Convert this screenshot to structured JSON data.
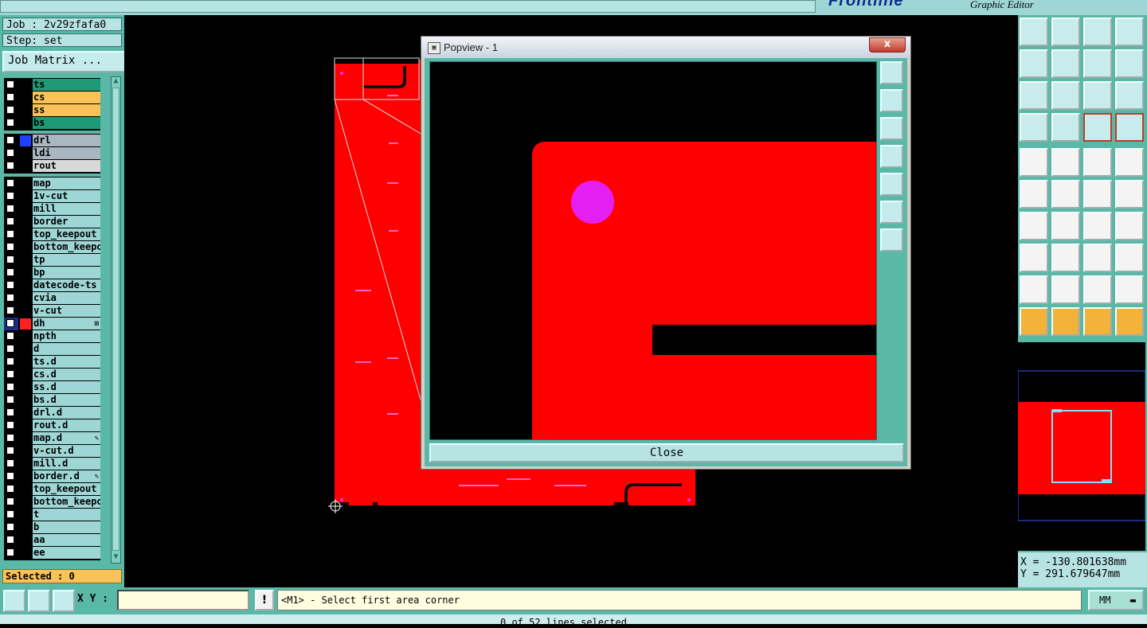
{
  "app": {
    "brand": "Frontline",
    "subtitle": "Graphic Editor"
  },
  "job": {
    "job_line": "Job : 2v29zfafa0",
    "step_line": "Step: set",
    "matrix_button": "Job Matrix ..."
  },
  "layers": [
    {
      "name": "ts",
      "color": "#1f9a76"
    },
    {
      "name": "cs",
      "color": "#f9c35a"
    },
    {
      "name": "ss",
      "color": "#f9c35a"
    },
    {
      "name": "bs",
      "color": "#1f9a76"
    },
    {
      "name": "drl",
      "color": "#a9b7c0",
      "swatch": "#1e40ff"
    },
    {
      "name": "ldi",
      "color": "#a9b7c0"
    },
    {
      "name": "rout",
      "color": "#d8d8d8"
    },
    {
      "name": "map",
      "color": "#9ed6d6"
    },
    {
      "name": "1v-cut",
      "color": "#9ed6d6"
    },
    {
      "name": "mill",
      "color": "#9ed6d6"
    },
    {
      "name": "border",
      "color": "#9ed6d6"
    },
    {
      "name": "top_keepout",
      "color": "#9ed6d6"
    },
    {
      "name": "bottom_keepout",
      "color": "#9ed6d6"
    },
    {
      "name": "tp",
      "color": "#9ed6d6"
    },
    {
      "name": "bp",
      "color": "#9ed6d6"
    },
    {
      "name": "datecode-ts",
      "color": "#9ed6d6"
    },
    {
      "name": "cvia",
      "color": "#9ed6d6"
    },
    {
      "name": "v-cut",
      "color": "#9ed6d6"
    },
    {
      "name": "dh",
      "color": "#9ed6d6",
      "swatch": "#ff2020",
      "active": true,
      "mark": "⊞"
    },
    {
      "name": "npth",
      "color": "#9ed6d6"
    },
    {
      "name": "d",
      "color": "#9ed6d6"
    },
    {
      "name": "ts.d",
      "color": "#9ed6d6"
    },
    {
      "name": "cs.d",
      "color": "#9ed6d6"
    },
    {
      "name": "ss.d",
      "color": "#9ed6d6"
    },
    {
      "name": "bs.d",
      "color": "#9ed6d6"
    },
    {
      "name": "drl.d",
      "color": "#9ed6d6"
    },
    {
      "name": "rout.d",
      "color": "#9ed6d6"
    },
    {
      "name": "map.d",
      "color": "#9ed6d6",
      "mark": "✎"
    },
    {
      "name": "v-cut.d",
      "color": "#9ed6d6"
    },
    {
      "name": "mill.d",
      "color": "#9ed6d6"
    },
    {
      "name": "border.d",
      "color": "#9ed6d6",
      "mark": "✎"
    },
    {
      "name": "top_keepout",
      "color": "#9ed6d6"
    },
    {
      "name": "bottom_keepout",
      "color": "#9ed6d6"
    },
    {
      "name": "t",
      "color": "#9ed6d6"
    },
    {
      "name": "b",
      "color": "#9ed6d6"
    },
    {
      "name": "aa",
      "color": "#9ed6d6"
    },
    {
      "name": "ee",
      "color": "#9ed6d6"
    }
  ],
  "selected_text": "Selected : 0",
  "popup": {
    "title": "Popview - 1",
    "close_label": "Close",
    "close_x": "x"
  },
  "coords": {
    "x": "X = -130.801638mm",
    "y": "Y = 291.679647mm"
  },
  "bottom": {
    "xy_label": "X Y :",
    "xy_value": "",
    "excl": "!",
    "status": "<M1> - Select first area corner",
    "units": "MM"
  },
  "footer": "0 of 52 lines selected",
  "toolbar_icons": [
    "home-layer-icon",
    "load-icon",
    "house-icon",
    "window-icon",
    "left-icon",
    "right-icon",
    "swap-icon",
    "undo-s-icon",
    "fit-icon",
    "zoom-center-icon",
    "ratio-icon",
    "help-icon",
    "tools-icon",
    "grid-icon",
    "snap-red-icon",
    "snap-red-2-icon",
    "pad-icon",
    "route-icon",
    "ruler-icon",
    "circle-icon",
    "connect-icon",
    "cross-icon",
    "red-dot-line-icon",
    "red-dot-line-2-icon",
    "angle-icon",
    "line-icon",
    "rotate-icon",
    "mirror-icon",
    "move-pad-icon",
    "trim-icon",
    "measure-icon",
    "circles-icon",
    "triangle-icon",
    "triangle-2-icon",
    "triangle-3-icon",
    "triangle-4-icon",
    "pointer-icon",
    "pointer-box-icon",
    "pointer-orange-icon",
    "pointer-net-icon"
  ]
}
